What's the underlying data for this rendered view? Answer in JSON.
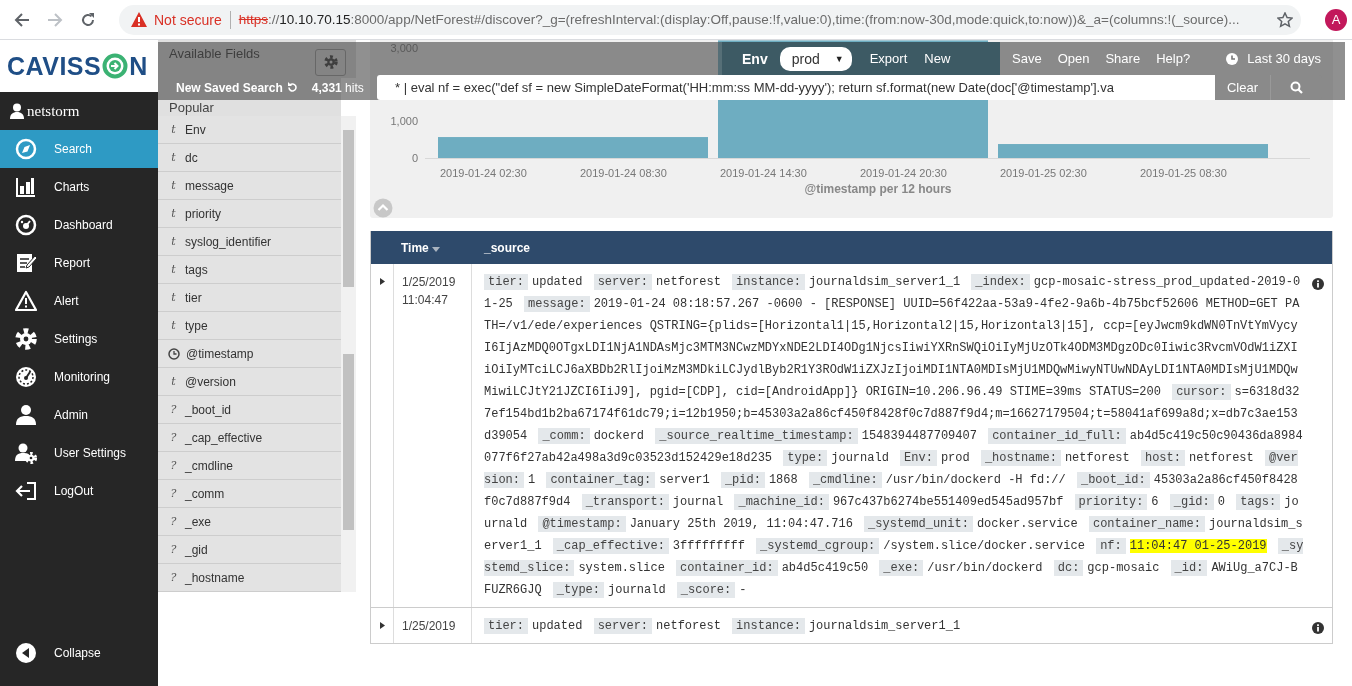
{
  "browser": {
    "security_label": "Not secure",
    "url": {
      "scheme": "https",
      "separator": "://",
      "host": "10.10.70.15",
      "path": ":8000/app/NetForest#/discover?_g=(refreshInterval:(display:Off,pause:!f,value:0),time:(from:now-30d,mode:quick,to:now))&_a=(columns:!(_source)..."
    },
    "avatar": "A"
  },
  "logo": {
    "text_start": "CAVISS",
    "text_end": "N"
  },
  "user": "netstorm",
  "nav": [
    {
      "label": "Search",
      "selected": true
    },
    {
      "label": "Charts",
      "selected": false
    },
    {
      "label": "Dashboard",
      "selected": false
    },
    {
      "label": "Report",
      "selected": false
    },
    {
      "label": "Alert",
      "selected": false
    },
    {
      "label": "Settings",
      "selected": false
    },
    {
      "label": "Monitoring",
      "selected": false
    },
    {
      "label": "Admin",
      "selected": false
    },
    {
      "label": "User Settings",
      "selected": false
    },
    {
      "label": "LogOut",
      "selected": false
    }
  ],
  "collapse": "Collapse",
  "fields_panel": {
    "title": "Available Fields",
    "section": "Popular",
    "popular": [
      {
        "kind": "text",
        "type_label": "t",
        "name": "Env"
      },
      {
        "kind": "text",
        "type_label": "t",
        "name": "dc"
      },
      {
        "kind": "text",
        "type_label": "t",
        "name": "message"
      },
      {
        "kind": "text",
        "type_label": "t",
        "name": "priority"
      },
      {
        "kind": "text",
        "type_label": "t",
        "name": "syslog_identifier"
      },
      {
        "kind": "text",
        "type_label": "t",
        "name": "tags"
      },
      {
        "kind": "text",
        "type_label": "t",
        "name": "tier"
      },
      {
        "kind": "text",
        "type_label": "t",
        "name": "type"
      }
    ],
    "fields": [
      {
        "kind": "date",
        "name": "@timestamp"
      },
      {
        "kind": "text",
        "type_label": "t",
        "name": "@version"
      },
      {
        "kind": "unknown",
        "type_label": "?",
        "name": "_boot_id"
      },
      {
        "kind": "unknown",
        "type_label": "?",
        "name": "_cap_effective"
      },
      {
        "kind": "unknown",
        "type_label": "?",
        "name": "_cmdline"
      },
      {
        "kind": "unknown",
        "type_label": "?",
        "name": "_comm"
      },
      {
        "kind": "unknown",
        "type_label": "?",
        "name": "_exe"
      },
      {
        "kind": "unknown",
        "type_label": "?",
        "name": "_gid"
      },
      {
        "kind": "unknown",
        "type_label": "?",
        "name": "_hostname"
      }
    ]
  },
  "toolbar": {
    "saved_search": "New Saved Search",
    "hits_count": "4,331",
    "hits_label": "hits",
    "env_label": "Env",
    "env_value": "prod",
    "env_caret": "▼",
    "actions": [
      "Export",
      "New",
      "Save",
      "Open",
      "Share",
      "Help?"
    ],
    "time_range": "Last 30 days",
    "query": "* | eval nf = exec(\"def sf = new SimpleDateFormat('HH:mm:ss MM-dd-yyyy'); return sf.format(new Date(doc['@timestamp'].va",
    "clear": "Clear"
  },
  "histogram": {
    "chart_data": {
      "type": "bar",
      "xlabel": "@timestamp per 12 hours",
      "categories": [
        null,
        null,
        null
      ],
      "values": [
        570,
        3200,
        380
      ],
      "ylim": [
        0,
        3200
      ],
      "annotations": [
        "2019-01-24 02:30",
        "2019-01-24 08:30",
        "2019-01-24 14:30",
        "2019-01-24 20:30",
        "2019-01-25 02:30",
        "2019-01-25 08:30"
      ],
      "yticks": [
        {
          "value": 0,
          "label": "0"
        },
        {
          "value": 1000,
          "label": "1,000"
        },
        {
          "value": 3000,
          "label": "3,000"
        }
      ]
    }
  },
  "table": {
    "columns": [
      "Time",
      "_source"
    ],
    "rows": [
      {
        "expanded": false,
        "time": "1/25/2019 11:04:47",
        "source": [
          {
            "key": "tier:",
            "value": "updated",
            "highlighted": false
          },
          {
            "key": "server:",
            "value": "netforest",
            "highlighted": false
          },
          {
            "key": "instance:",
            "value": "journaldsim_server1_1",
            "highlighted": false
          },
          {
            "key": "_index:",
            "value": "gcp-mosaic-stress_prod_updated-2019-01-25",
            "highlighted": false
          },
          {
            "key": "message:",
            "value": "2019-01-24 08:18:57.267 -0600 - [RESPONSE] UUID=56f422aa-53a9-4fe2-9a6b-4b75bcf52606 METHOD=GET PATH=/v1/ede/experiences QSTRING={plids=[Horizontal1|15,Horizontal2|15,Horizontal3|15], ccp=[eyJwcm9kdWN0TnVtYmVycyI6IjAzMDQ0OTgxLDI1NjA1NDAsMjc3MTM3NCwzMDYxNDE2LDI4ODg1NjcsIiwiYXRnSWQiOiIyMjUzOTk4ODM3MDgzODc0Iiwic3RvcmVOdW1iZXIiOiIyMTciLCJ6aXBDb2RlIjoiMzM3MDkiLCJydlByb2R1Y3ROdW1iZXJzIjoiMDI1NTA0MDIsMjU1MDQwMiwyNTUwNDAyLDI1NTA0MDIsMjU1MDQwMiwiLCJtY21JZCI6IiJ9], pgid=[CDP], cid=[AndroidApp]} ORIGIN=10.206.96.49 STIME=39ms STATUS=200",
            "highlighted": false
          },
          {
            "key": "cursor:",
            "value": "s=6318d327ef154bd1b2ba67174f61dc79;i=12b1950;b=45303a2a86cf450f8428f0c7d887f9d4;m=16627179504;t=58041af699a8d;x=db7c3ae153d39054",
            "highlighted": false
          },
          {
            "key": "_comm:",
            "value": "dockerd",
            "highlighted": false
          },
          {
            "key": "_source_realtime_timestamp:",
            "value": "1548394487709407",
            "highlighted": false
          },
          {
            "key": "container_id_full:",
            "value": "ab4d5c419c50c90436da8984077f6f27ab42a498a3d9c03523d152429e18d235",
            "highlighted": false
          },
          {
            "key": "type:",
            "value": "journald",
            "highlighted": false
          },
          {
            "key": "Env:",
            "value": "prod",
            "highlighted": false
          },
          {
            "key": "_hostname:",
            "value": "netforest",
            "highlighted": false
          },
          {
            "key": "host:",
            "value": "netforest",
            "highlighted": false
          },
          {
            "key": "@version:",
            "value": "1",
            "highlighted": false
          },
          {
            "key": "container_tag:",
            "value": "server1",
            "highlighted": false
          },
          {
            "key": "_pid:",
            "value": "1868",
            "highlighted": false
          },
          {
            "key": "_cmdline:",
            "value": "/usr/bin/dockerd -H fd://",
            "highlighted": false
          },
          {
            "key": "_boot_id:",
            "value": "45303a2a86cf450f8428f0c7d887f9d4",
            "highlighted": false
          },
          {
            "key": "_transport:",
            "value": "journal",
            "highlighted": false
          },
          {
            "key": "_machine_id:",
            "value": "967c437b6274be551409ed545ad957bf",
            "highlighted": false
          },
          {
            "key": "priority:",
            "value": "6",
            "highlighted": false
          },
          {
            "key": "_gid:",
            "value": "0",
            "highlighted": false
          },
          {
            "key": "tags:",
            "value": "journald",
            "highlighted": false
          },
          {
            "key": "@timestamp:",
            "value": "January 25th 2019, 11:04:47.716",
            "highlighted": false
          },
          {
            "key": "_systemd_unit:",
            "value": "docker.service",
            "highlighted": false
          },
          {
            "key": "container_name:",
            "value": "journaldsim_server1_1",
            "highlighted": false
          },
          {
            "key": "_cap_effective:",
            "value": "3fffffffff",
            "highlighted": false
          },
          {
            "key": "_systemd_cgroup:",
            "value": "/system.slice/docker.service",
            "highlighted": false
          },
          {
            "key": "nf:",
            "value": "11:04:47 01-25-2019",
            "highlighted": true
          },
          {
            "key": "_systemd_slice:",
            "value": "system.slice",
            "highlighted": false
          },
          {
            "key": "container_id:",
            "value": "ab4d5c419c50",
            "highlighted": false
          },
          {
            "key": "_exe:",
            "value": "/usr/bin/dockerd",
            "highlighted": false
          },
          {
            "key": "dc:",
            "value": "gcp-mosaic",
            "highlighted": false
          },
          {
            "key": "_id:",
            "value": "AWiUg_a7CJ-BFUZR6GJQ",
            "highlighted": false
          },
          {
            "key": "_type:",
            "value": "journald",
            "highlighted": false
          },
          {
            "key": "_score:",
            "value": "-",
            "highlighted": false
          }
        ]
      },
      {
        "expanded": false,
        "time": "1/25/2019",
        "source": [
          {
            "key": "tier:",
            "value": "updated",
            "highlighted": false
          },
          {
            "key": "server:",
            "value": "netforest",
            "highlighted": false
          },
          {
            "key": "instance:",
            "value": "journaldsim_server1_1",
            "highlighted": false
          }
        ]
      }
    ]
  }
}
